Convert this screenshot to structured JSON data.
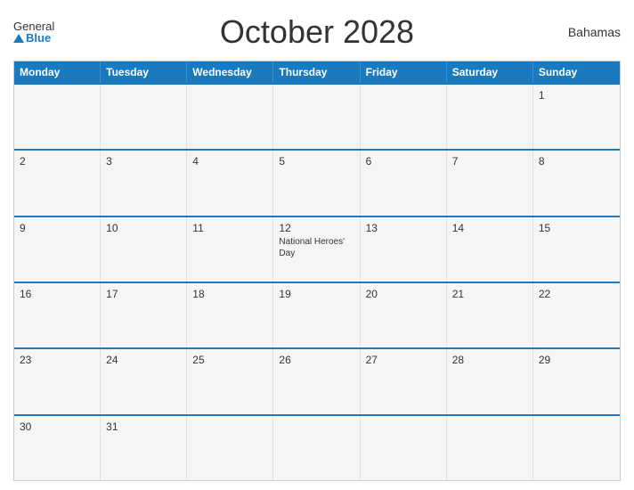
{
  "logo": {
    "general": "General",
    "blue": "Blue"
  },
  "header": {
    "title": "October 2028",
    "country": "Bahamas"
  },
  "calendar": {
    "days": [
      "Monday",
      "Tuesday",
      "Wednesday",
      "Thursday",
      "Friday",
      "Saturday",
      "Sunday"
    ],
    "rows": [
      [
        {
          "day": "",
          "empty": true
        },
        {
          "day": "",
          "empty": true
        },
        {
          "day": "",
          "empty": true
        },
        {
          "day": "",
          "empty": true
        },
        {
          "day": "",
          "empty": true
        },
        {
          "day": "",
          "empty": true
        },
        {
          "day": "1",
          "empty": false,
          "event": ""
        }
      ],
      [
        {
          "day": "2",
          "empty": false,
          "event": ""
        },
        {
          "day": "3",
          "empty": false,
          "event": ""
        },
        {
          "day": "4",
          "empty": false,
          "event": ""
        },
        {
          "day": "5",
          "empty": false,
          "event": ""
        },
        {
          "day": "6",
          "empty": false,
          "event": ""
        },
        {
          "day": "7",
          "empty": false,
          "event": ""
        },
        {
          "day": "8",
          "empty": false,
          "event": ""
        }
      ],
      [
        {
          "day": "9",
          "empty": false,
          "event": ""
        },
        {
          "day": "10",
          "empty": false,
          "event": ""
        },
        {
          "day": "11",
          "empty": false,
          "event": ""
        },
        {
          "day": "12",
          "empty": false,
          "event": "National Heroes' Day"
        },
        {
          "day": "13",
          "empty": false,
          "event": ""
        },
        {
          "day": "14",
          "empty": false,
          "event": ""
        },
        {
          "day": "15",
          "empty": false,
          "event": ""
        }
      ],
      [
        {
          "day": "16",
          "empty": false,
          "event": ""
        },
        {
          "day": "17",
          "empty": false,
          "event": ""
        },
        {
          "day": "18",
          "empty": false,
          "event": ""
        },
        {
          "day": "19",
          "empty": false,
          "event": ""
        },
        {
          "day": "20",
          "empty": false,
          "event": ""
        },
        {
          "day": "21",
          "empty": false,
          "event": ""
        },
        {
          "day": "22",
          "empty": false,
          "event": ""
        }
      ],
      [
        {
          "day": "23",
          "empty": false,
          "event": ""
        },
        {
          "day": "24",
          "empty": false,
          "event": ""
        },
        {
          "day": "25",
          "empty": false,
          "event": ""
        },
        {
          "day": "26",
          "empty": false,
          "event": ""
        },
        {
          "day": "27",
          "empty": false,
          "event": ""
        },
        {
          "day": "28",
          "empty": false,
          "event": ""
        },
        {
          "day": "29",
          "empty": false,
          "event": ""
        }
      ],
      [
        {
          "day": "30",
          "empty": false,
          "event": ""
        },
        {
          "day": "31",
          "empty": false,
          "event": ""
        },
        {
          "day": "",
          "empty": true
        },
        {
          "day": "",
          "empty": true
        },
        {
          "day": "",
          "empty": true
        },
        {
          "day": "",
          "empty": true
        },
        {
          "day": "",
          "empty": true
        }
      ]
    ]
  }
}
